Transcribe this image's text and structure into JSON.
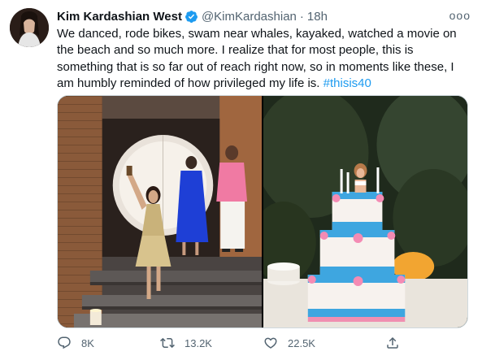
{
  "tweet": {
    "author_name": "Kim Kardashian West",
    "handle": "@KimKardashian",
    "separator": "·",
    "time": "18h",
    "more_label": "ooo",
    "text_main": "We danced, rode bikes, swam near whales, kayaked, watched a movie on the beach and so much more. I realize that for most people, this is something that is so far out of reach right now, so in moments like these, I am humbly reminded of how privileged my life is. ",
    "hashtag": "#thisis40"
  },
  "actions": {
    "reply_count": "8K",
    "retweet_count": "13.2K",
    "like_count": "22.5K"
  },
  "icons": {
    "verified": "verified-badge-icon",
    "reply": "reply-icon",
    "retweet": "retweet-icon",
    "like": "heart-icon",
    "share": "share-icon",
    "more": "more-icon"
  },
  "colors": {
    "link": "#1d9bf0",
    "secondary_text": "#536471",
    "verified": "#1d9bf0",
    "border": "#cfd9de"
  }
}
